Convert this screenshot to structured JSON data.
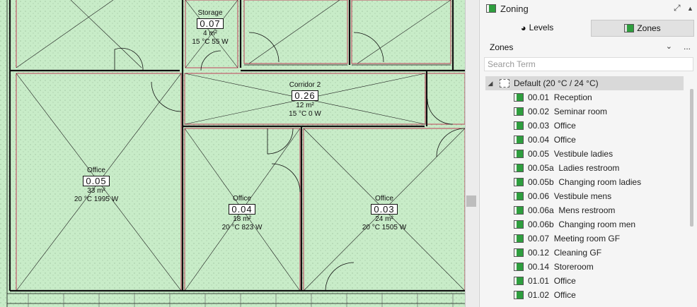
{
  "panel": {
    "title": "Zoning",
    "icon": "zone-icon",
    "expand_icon": "expand-icon",
    "menu_icon": "caret-up-icon",
    "tabs": [
      {
        "label": "Levels",
        "icon": "levels-icon"
      },
      {
        "label": "Zones",
        "icon": "zone-icon",
        "active": true
      }
    ],
    "dropdown": {
      "value": "Zones",
      "icon": "chevron-down-icon"
    },
    "more_label": "...",
    "search": {
      "placeholder": "Search Term"
    },
    "tree": {
      "group": {
        "label": "Default (20 °C / 24 °C)",
        "expanded": true
      },
      "items": [
        {
          "label": "00.01  Reception"
        },
        {
          "label": "00.02  Seminar room"
        },
        {
          "label": "00.03  Office"
        },
        {
          "label": "00.04  Office"
        },
        {
          "label": "00.05  Vestibule ladies"
        },
        {
          "label": "00.05a  Ladies restroom"
        },
        {
          "label": "00.05b  Changing room ladies"
        },
        {
          "label": "00.06  Vestibule mens"
        },
        {
          "label": "00.06a  Mens restroom"
        },
        {
          "label": "00.06b  Changing room men"
        },
        {
          "label": "00.07  Meeting room GF"
        },
        {
          "label": "00.12  Cleaning GF"
        },
        {
          "label": "00.14  Storeroom"
        },
        {
          "label": "01.01  Office"
        },
        {
          "label": "01.02  Office"
        }
      ]
    }
  },
  "plan": {
    "background": "#c8ecc8",
    "wall_color": "#111111",
    "zone_border_color": "#c0405a",
    "rooms": [
      {
        "name": "Storage",
        "number": "0.07",
        "area": "4 m²",
        "info": "15 °C  55 W"
      },
      {
        "name": "Corridor 2",
        "number": "0.26",
        "area": "12 m²",
        "info": "15 °C  0 W"
      },
      {
        "name": "Office",
        "number": "0.05",
        "area": "33 m²",
        "info": "20 °C  1995 W"
      },
      {
        "name": "Office",
        "number": "0.04",
        "area": "18 m²",
        "info": "20 °C  823 W"
      },
      {
        "name": "Office",
        "number": "0.03",
        "area": "24 m²",
        "info": "20 °C  1505 W"
      }
    ]
  }
}
